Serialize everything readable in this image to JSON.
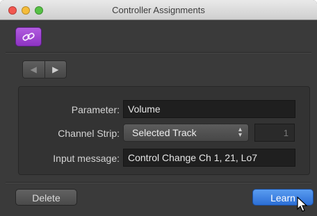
{
  "window": {
    "title": "Controller Assignments"
  },
  "toolbar": {
    "link_icon": "link-icon",
    "link_color": "#9b3fd0"
  },
  "nav": {
    "back_icon": "triangle-left-icon",
    "forward_icon": "triangle-right-icon",
    "back_glyph": "◀",
    "forward_glyph": "▶"
  },
  "form": {
    "parameter_label": "Parameter:",
    "parameter_value": "Volume",
    "channel_strip_label": "Channel Strip:",
    "channel_strip_value": "Selected Track",
    "channel_number": "1",
    "input_message_label": "Input message:",
    "input_message_value": "Control Change Ch 1, 21, Lo7"
  },
  "buttons": {
    "delete_label": "Delete",
    "learn_label": "Learn",
    "learn_color": "#2f74dc"
  }
}
